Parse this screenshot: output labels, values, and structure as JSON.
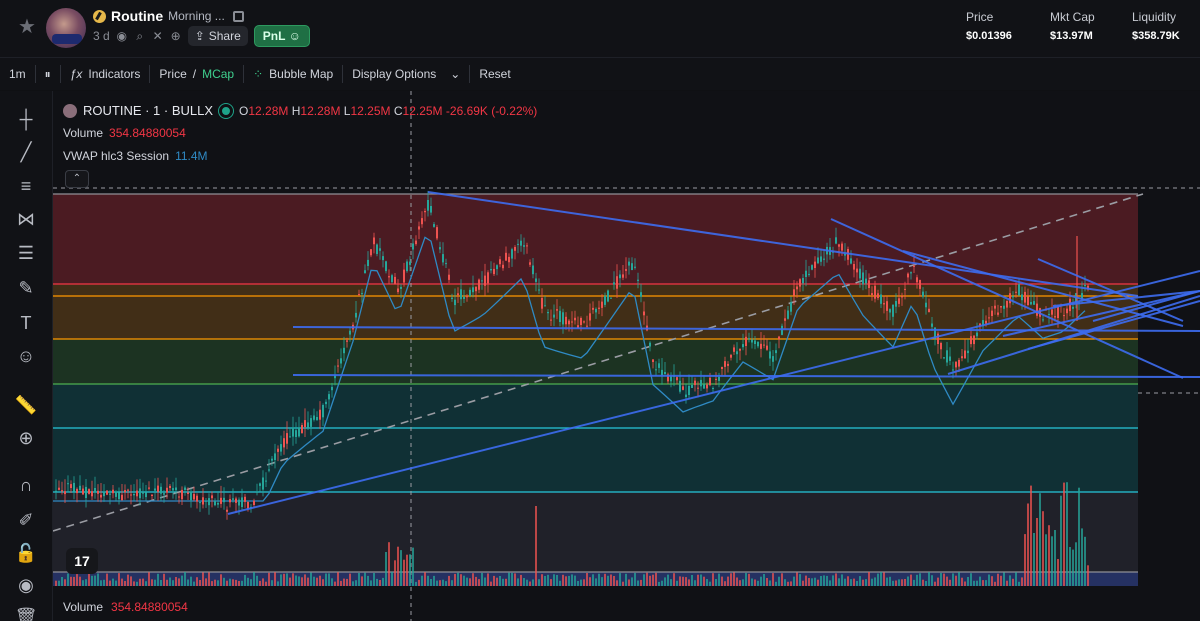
{
  "header": {
    "token_name": "Routine",
    "token_desc": "Morning ...",
    "age": "3 d",
    "share_label": "Share",
    "pnl_label": "PnL",
    "stats": [
      {
        "label": "Price",
        "value": "$0.01396"
      },
      {
        "label": "Mkt Cap",
        "value": "$13.97M"
      },
      {
        "label": "Liquidity",
        "value": "$358.79K"
      }
    ]
  },
  "toolbar": {
    "interval": "1m",
    "indicators": "Indicators",
    "price_label": "Price",
    "price_sep": "/",
    "mcap_label": "MCap",
    "bubble_map": "Bubble Map",
    "display_options": "Display Options",
    "reset": "Reset"
  },
  "chart": {
    "symbol": "ROUTINE · 1 · BULLX",
    "ohlc": {
      "o_label": "O",
      "o": "12.28M",
      "h_label": "H",
      "h": "12.28M",
      "l_label": "L",
      "l": "12.25M",
      "c_label": "C",
      "c": "12.25M",
      "change": "-26.69K (-0.22%)"
    },
    "volume_label": "Volume",
    "volume_value": "354.84880054",
    "vwap_label": "VWAP hlc3 Session",
    "vwap_value": "11.4M",
    "tv_logo": "17"
  },
  "colors": {
    "accent_green": "#3fcf8e",
    "candle_up": "#26a69a",
    "candle_down": "#ef5350",
    "trendline": "#3d6cf0",
    "vwap": "#2f8ac4",
    "zone_red": "#5a1e25",
    "zone_orange": "#4a3418",
    "zone_green": "#1f3a25",
    "zone_teal": "#10363b",
    "line_red": "#f23645",
    "line_orange": "#ff9800",
    "line_green": "#4caf50",
    "line_teal": "#26c6da"
  },
  "icons": {
    "left_rail": [
      "crosshair-icon",
      "trendline-icon",
      "horizontal-lines-icon",
      "pattern-icon",
      "fib-icon",
      "brush-icon",
      "text-icon",
      "emoji-icon",
      "ruler-icon",
      "zoom-icon",
      "magnet-icon",
      "lock-drawing-icon",
      "lock-icon",
      "eye-icon",
      "trash-icon"
    ]
  }
}
